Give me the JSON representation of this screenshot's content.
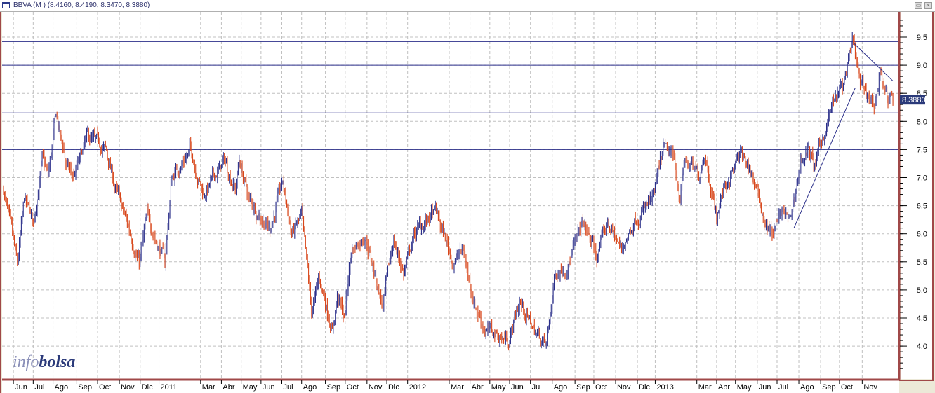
{
  "window": {
    "title": "BBVA (M ) (8.4160, 8.4190, 8.3470, 8.3880)",
    "restore_icon": "restore-icon",
    "close_icon": "close-icon"
  },
  "logo": {
    "part1": "info",
    "part2": "bolsa"
  },
  "colors": {
    "up": "#2b2f8a",
    "down": "#d8461a",
    "frame": "#a04848",
    "grid": "#c0c0c0",
    "level": "#2b2f8a",
    "last_bg": "#2b3a7a"
  },
  "chart_data": {
    "type": "ohlc",
    "symbol": "BBVA",
    "last_price_label": "8.3880",
    "last_price": 8.388,
    "sessions": 899,
    "ylim": [
      3.55,
      9.9
    ],
    "y_ticks": [
      "4.0",
      "4.5",
      "5.0",
      "5.5",
      "6.0",
      "6.5",
      "7.0",
      "7.5",
      "8.0",
      "8.5",
      "9.0",
      "9.5"
    ],
    "x_ticks": [
      {
        "label": "Jun",
        "i": 10
      },
      {
        "label": "Jul",
        "i": 30
      },
      {
        "label": "Ago",
        "i": 50
      },
      {
        "label": "Sep",
        "i": 74
      },
      {
        "label": "Oct",
        "i": 95
      },
      {
        "label": "Nov",
        "i": 117
      },
      {
        "label": "Dic",
        "i": 138
      },
      {
        "label": "2011",
        "i": 157
      },
      {
        "label": "Mar",
        "i": 199
      },
      {
        "label": "Abr",
        "i": 220
      },
      {
        "label": "May",
        "i": 240
      },
      {
        "label": "Jun",
        "i": 260
      },
      {
        "label": "Jul",
        "i": 281
      },
      {
        "label": "Ago",
        "i": 301
      },
      {
        "label": "Sep",
        "i": 325
      },
      {
        "label": "Oct",
        "i": 345
      },
      {
        "label": "Nov",
        "i": 367
      },
      {
        "label": "Dic",
        "i": 387
      },
      {
        "label": "2012",
        "i": 408
      },
      {
        "label": "Mar",
        "i": 450
      },
      {
        "label": "Abr",
        "i": 471
      },
      {
        "label": "May",
        "i": 491
      },
      {
        "label": "Jun",
        "i": 511
      },
      {
        "label": "Jul",
        "i": 532
      },
      {
        "label": "Ago",
        "i": 554
      },
      {
        "label": "Sep",
        "i": 577
      },
      {
        "label": "Oct",
        "i": 596
      },
      {
        "label": "Nov",
        "i": 618
      },
      {
        "label": "Dic",
        "i": 640
      },
      {
        "label": "2013",
        "i": 658
      },
      {
        "label": "Mar",
        "i": 700
      },
      {
        "label": "Abr",
        "i": 720
      },
      {
        "label": "May",
        "i": 739
      },
      {
        "label": "Jun",
        "i": 761
      },
      {
        "label": "Jul",
        "i": 781
      },
      {
        "label": "Ago",
        "i": 803
      },
      {
        "label": "Sep",
        "i": 825
      },
      {
        "label": "Oct",
        "i": 844
      },
      {
        "label": "Nov",
        "i": 867
      }
    ],
    "price_anchors": [
      [
        0,
        6.8
      ],
      [
        14,
        5.4
      ],
      [
        21,
        6.6
      ],
      [
        30,
        6.2
      ],
      [
        39,
        7.3
      ],
      [
        45,
        7.0
      ],
      [
        53,
        8.1
      ],
      [
        64,
        7.2
      ],
      [
        71,
        7.0
      ],
      [
        85,
        7.7
      ],
      [
        103,
        7.5
      ],
      [
        113,
        6.8
      ],
      [
        128,
        6.0
      ],
      [
        137,
        5.5
      ],
      [
        145,
        6.3
      ],
      [
        163,
        5.5
      ],
      [
        170,
        7.0
      ],
      [
        189,
        7.5
      ],
      [
        202,
        6.7
      ],
      [
        223,
        7.3
      ],
      [
        234,
        6.8
      ],
      [
        238,
        7.3
      ],
      [
        248,
        6.6
      ],
      [
        269,
        6.1
      ],
      [
        282,
        6.9
      ],
      [
        291,
        6.0
      ],
      [
        301,
        6.3
      ],
      [
        311,
        4.6
      ],
      [
        319,
        5.2
      ],
      [
        332,
        4.3
      ],
      [
        337,
        4.9
      ],
      [
        344,
        4.5
      ],
      [
        351,
        5.7
      ],
      [
        365,
        6.0
      ],
      [
        383,
        4.7
      ],
      [
        394,
        5.9
      ],
      [
        404,
        5.3
      ],
      [
        415,
        6.0
      ],
      [
        436,
        6.4
      ],
      [
        454,
        5.5
      ],
      [
        464,
        5.7
      ],
      [
        475,
        4.8
      ],
      [
        486,
        4.3
      ],
      [
        510,
        4.1
      ],
      [
        521,
        4.8
      ],
      [
        535,
        4.3
      ],
      [
        548,
        4.0
      ],
      [
        557,
        5.3
      ],
      [
        571,
        5.5
      ],
      [
        585,
        6.2
      ],
      [
        599,
        5.6
      ],
      [
        610,
        6.2
      ],
      [
        624,
        5.7
      ],
      [
        638,
        6.3
      ],
      [
        656,
        6.6
      ],
      [
        666,
        7.5
      ],
      [
        677,
        7.3
      ],
      [
        683,
        6.7
      ],
      [
        688,
        7.3
      ],
      [
        702,
        7.0
      ],
      [
        708,
        7.5
      ],
      [
        720,
        6.3
      ],
      [
        727,
        6.8
      ],
      [
        744,
        7.4
      ],
      [
        755,
        7.1
      ],
      [
        769,
        6.2
      ],
      [
        776,
        6.0
      ],
      [
        787,
        6.4
      ],
      [
        794,
        6.2
      ],
      [
        805,
        7.3
      ],
      [
        812,
        7.5
      ],
      [
        819,
        7.2
      ],
      [
        837,
        8.3
      ],
      [
        847,
        8.6
      ],
      [
        858,
        9.4
      ],
      [
        865,
        8.6
      ],
      [
        872,
        8.5
      ],
      [
        879,
        8.3
      ],
      [
        886,
        8.9
      ],
      [
        893,
        8.3
      ],
      [
        898,
        8.388
      ]
    ],
    "horizontal_levels": [
      9.42,
      9.0,
      8.15,
      7.5
    ],
    "trendlines": [
      {
        "from": [
          798,
          6.1
        ],
        "to": [
          860,
          8.6
        ]
      },
      {
        "from": [
          858,
          9.4
        ],
        "to": [
          898,
          8.72
        ]
      }
    ]
  }
}
